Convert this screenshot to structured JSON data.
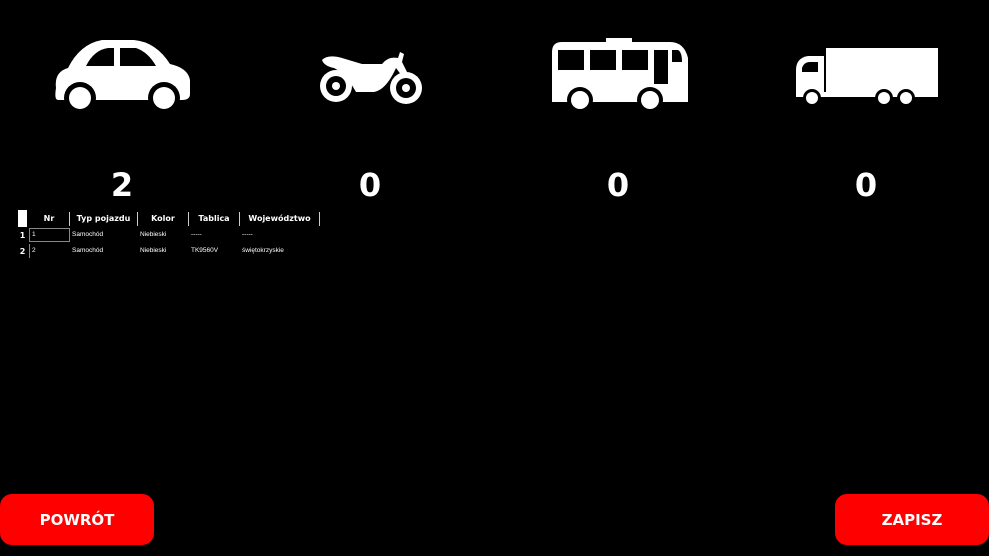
{
  "vehicles": [
    {
      "icon": "car-icon",
      "count": "2"
    },
    {
      "icon": "motorcycle-icon",
      "count": "0"
    },
    {
      "icon": "bus-icon",
      "count": "0"
    },
    {
      "icon": "truck-icon",
      "count": "0"
    }
  ],
  "table": {
    "headers": [
      "Nr",
      "Typ pojazdu",
      "Kolor",
      "Tablica",
      "Województwo"
    ],
    "rows": [
      {
        "num": "1",
        "nr": "1",
        "typ": "Samochód",
        "kolor": "Niebieski",
        "tablica": "-----",
        "woj": "-----"
      },
      {
        "num": "2",
        "nr": "2",
        "typ": "Samochód",
        "kolor": "Niebieski",
        "tablica": "TK9560V",
        "woj": "świętokrzyskie"
      }
    ]
  },
  "buttons": {
    "back": "POWRÓT",
    "save": "ZAPISZ"
  },
  "colors": {
    "background": "#000000",
    "button": "#ff0000",
    "text": "#ffffff"
  }
}
